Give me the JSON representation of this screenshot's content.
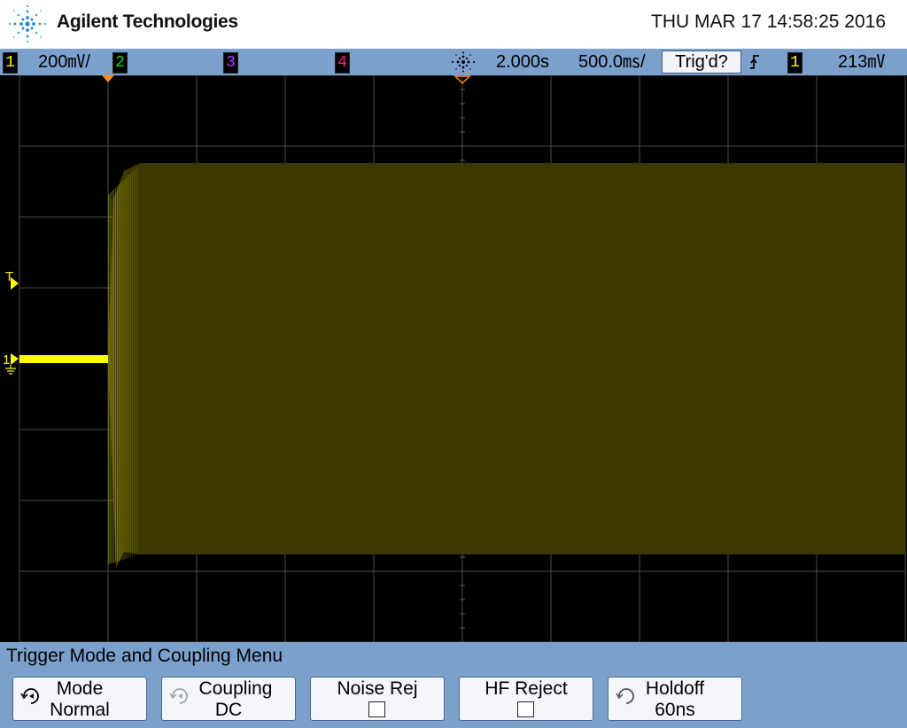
{
  "header": {
    "brand": "Agilent Technologies",
    "datetime": "THU MAR 17 14:58:25 2016"
  },
  "status_bar": {
    "ch1": {
      "number": "1",
      "scale": "200㎷/",
      "color": "#ffff00"
    },
    "ch2": {
      "number": "2",
      "color": "#22cc22"
    },
    "ch3": {
      "number": "3",
      "color": "#b040ff"
    },
    "ch4": {
      "number": "4",
      "color": "#ff2090"
    },
    "time_delay": "2.000s",
    "time_scale": "500.0㎳/",
    "trigger_status": "Trig'd?",
    "trigger_slope_icon": "rising-edge-icon",
    "trigger_source": "1",
    "trigger_level": "213㎷"
  },
  "display": {
    "trigger_marker_label": "T",
    "ch1_marker_label": "1",
    "trace_color": "#ffff00",
    "envelope_color": "#3b3800"
  },
  "menu": {
    "title": "Trigger Mode and Coupling Menu",
    "softkeys": [
      {
        "label": "Mode",
        "value": "Normal"
      },
      {
        "label": "Coupling",
        "value": "DC"
      },
      {
        "label": "Noise Rej",
        "checked": false
      },
      {
        "label": "HF Reject",
        "checked": false
      },
      {
        "label": "Holdoff",
        "value": "60ns"
      }
    ]
  }
}
